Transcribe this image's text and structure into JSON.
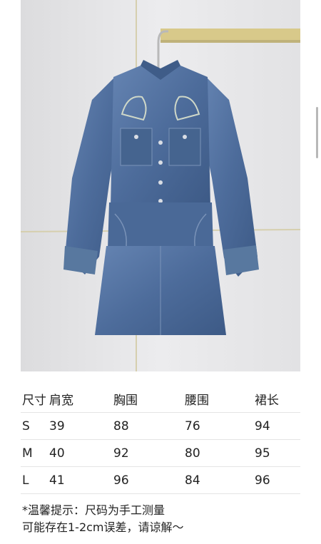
{
  "size_table": {
    "headers": [
      "尺寸",
      "肩宽",
      "胸围",
      "腰围",
      "裙长"
    ],
    "rows": [
      {
        "size": "S",
        "shoulder": "39",
        "chest": "88",
        "waist": "76",
        "length": "94"
      },
      {
        "size": "M",
        "shoulder": "40",
        "chest": "92",
        "waist": "80",
        "length": "95"
      },
      {
        "size": "L",
        "shoulder": "41",
        "chest": "96",
        "waist": "84",
        "length": "96"
      }
    ]
  },
  "note": {
    "line1": "*温馨提示：尺码为手工测量",
    "line2": "可能存在1-2cm误差，请谅解～"
  },
  "colors": {
    "denim": "#4f6f9f",
    "denim_dark": "#3b5680",
    "background": "#e6e6e8",
    "rail": "#d8c98a"
  }
}
